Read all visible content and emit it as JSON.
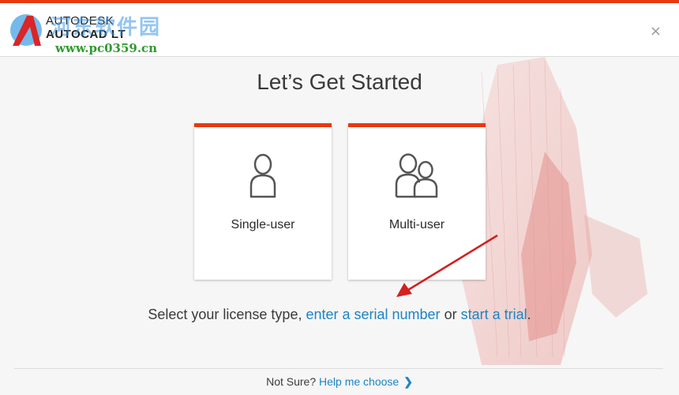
{
  "header": {
    "brand_line1": "AUTODESK",
    "brand_line2": "AUTOCAD LT",
    "watermark_cn": "河东软件园",
    "watermark_url": "www.pc0359.cn",
    "close_glyph": "×"
  },
  "main": {
    "title": "Let’s Get Started",
    "cards": [
      {
        "label": "Single-user",
        "icon": "single-user-icon"
      },
      {
        "label": "Multi-user",
        "icon": "multi-user-icon"
      }
    ],
    "prompt_prefix": "Select your license type, ",
    "serial_link": "enter a serial number",
    "prompt_or": " or ",
    "trial_link": "start a trial",
    "prompt_suffix": "."
  },
  "footer": {
    "not_sure": "Not Sure?",
    "help_link": "Help me choose",
    "chevron": "❯"
  },
  "colors": {
    "accent": "#e8380f",
    "link": "#1c84c6"
  }
}
